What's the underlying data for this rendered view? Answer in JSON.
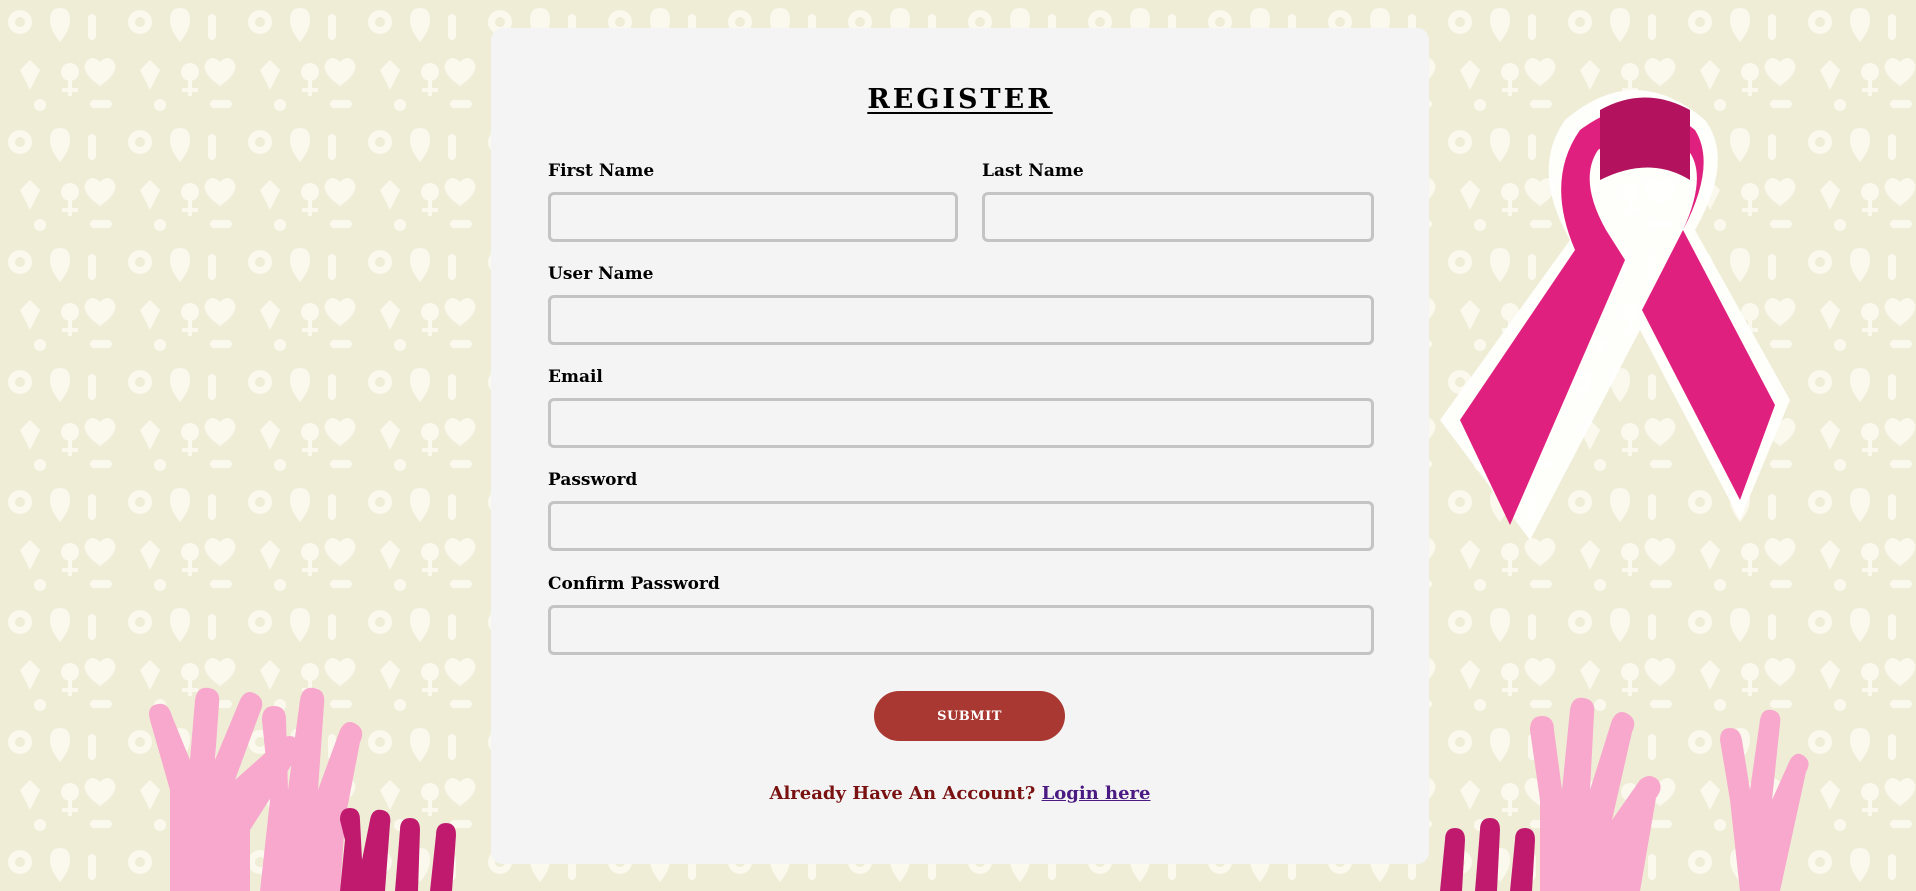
{
  "colors": {
    "background": "#f2f0dc",
    "card": "#f4f4f4",
    "submit": "#a93832",
    "question_text": "#7a1212",
    "link_text": "#4b1a82",
    "ribbon": "#e0207f",
    "hands_light": "#f7a8cc",
    "hands_dark": "#c01a6e"
  },
  "decor": {
    "ribbon_icon": "pink-awareness-ribbon-icon",
    "hands_icon": "raised-hands-icon",
    "pattern_icon": "awareness-symbols-pattern"
  },
  "form": {
    "title": "REGISTER",
    "fields": {
      "first_name": {
        "label": "First Name",
        "value": "",
        "placeholder": ""
      },
      "last_name": {
        "label": "Last Name",
        "value": "",
        "placeholder": ""
      },
      "user_name": {
        "label": "User Name",
        "value": "",
        "placeholder": ""
      },
      "email": {
        "label": "Email",
        "value": "",
        "placeholder": ""
      },
      "password": {
        "label": "Password",
        "value": "",
        "placeholder": ""
      },
      "confirm_password": {
        "label": "Confirm Password",
        "value": "",
        "placeholder": ""
      }
    },
    "submit_label": "SUBMIT",
    "login_prompt": "Already Have An Account?",
    "login_link": "Login here"
  }
}
